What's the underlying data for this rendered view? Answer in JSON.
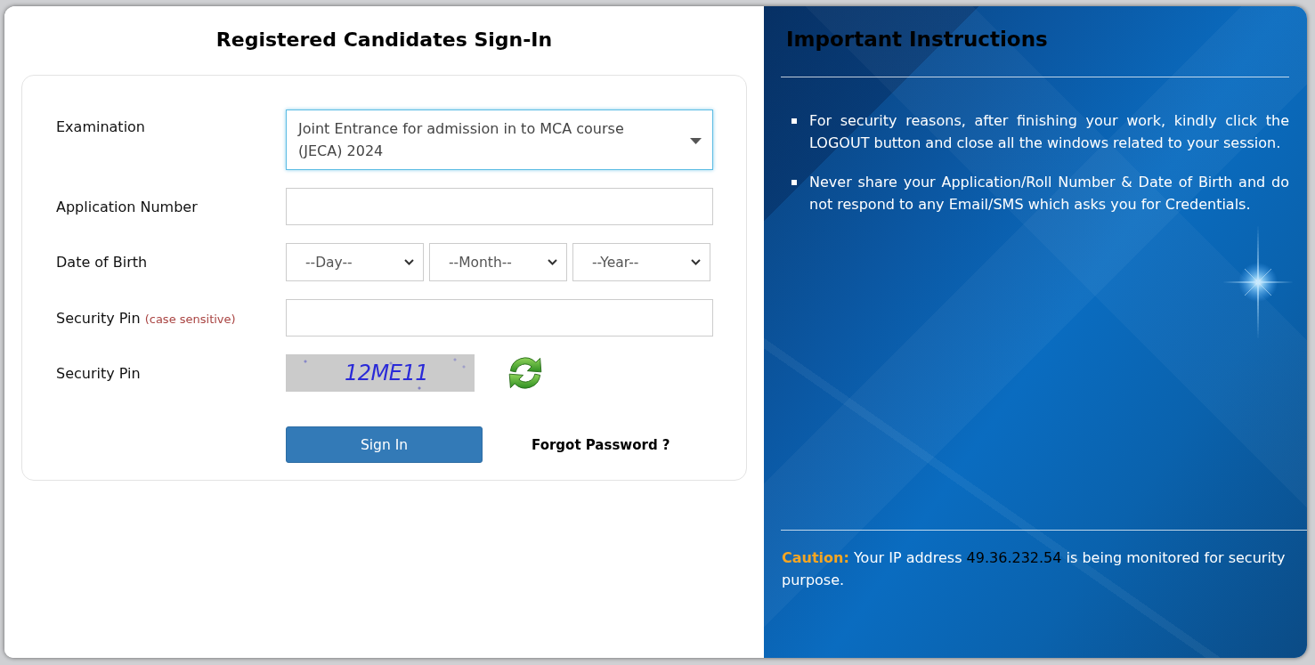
{
  "login": {
    "title": "Registered Candidates Sign-In",
    "fields": [
      {
        "kind": "dropdown",
        "label": "Examination",
        "value": "Joint Entrance for admission in to MCA course (JECA) 2024",
        "focused": true
      },
      {
        "kind": "text",
        "label": "Application Number",
        "focused": false
      },
      {
        "kind": "date",
        "label": "Date of Birth",
        "selects": [
          "--Day--",
          "--Month--",
          "--Year--"
        ]
      },
      {
        "kind": "text",
        "label": "Security Pin",
        "hint": "(case sensitive)",
        "focused": false
      },
      {
        "kind": "captcha",
        "label": "Security Pin",
        "captcha": "12ME11"
      }
    ],
    "sign_in_button": "Sign In",
    "forgot_password_link": "Forgot Password ?"
  },
  "instructions": {
    "title": "Important Instructions",
    "items": [
      "For security reasons, after finishing your work, kindly click the LOGOUT button and close all the windows related to your session.",
      "Never share your Application/Roll Number & Date of Birth and do not respond to any Email/SMS which asks you for Credentials."
    ],
    "caution": {
      "label": "Caution:",
      "text_before": "Your IP address",
      "ip": "49.36.232.54",
      "text_after": "is being monitored for security purpose."
    }
  }
}
